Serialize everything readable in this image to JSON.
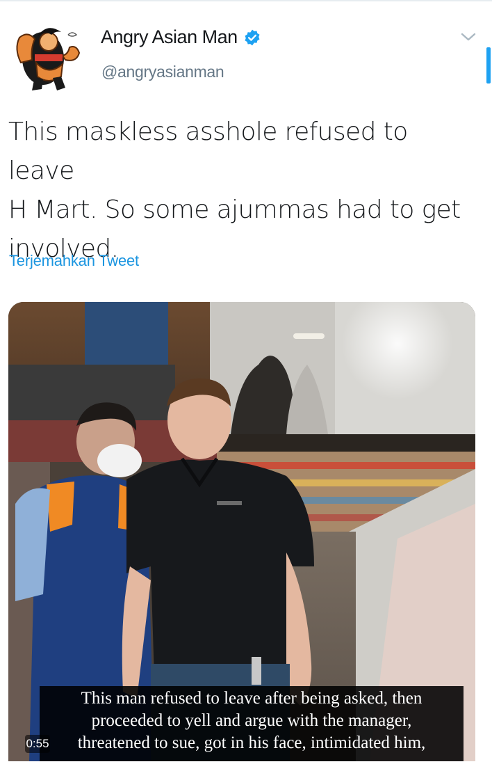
{
  "tweet": {
    "display_name": "Angry Asian Man",
    "handle": "@angryasianman",
    "verified": true,
    "text_lines": [
      "This maskless asshole refused to leave",
      "H Mart. So some ajummas had to get",
      "involved."
    ],
    "translate_label": "Terjemahkan Tweet"
  },
  "icons": {
    "verified": "verified-badge-icon",
    "more": "chevron-down-icon"
  },
  "video": {
    "duration": "0:55",
    "caption_lines": [
      "This man refused to leave after being asked, then",
      "proceeded to yell and argue with the manager,",
      "threatened to sue, got in his face, intimidated him,"
    ]
  },
  "colors": {
    "link": "#1b95e0",
    "verified": "#1da1f2",
    "secondary_text": "#657786"
  }
}
